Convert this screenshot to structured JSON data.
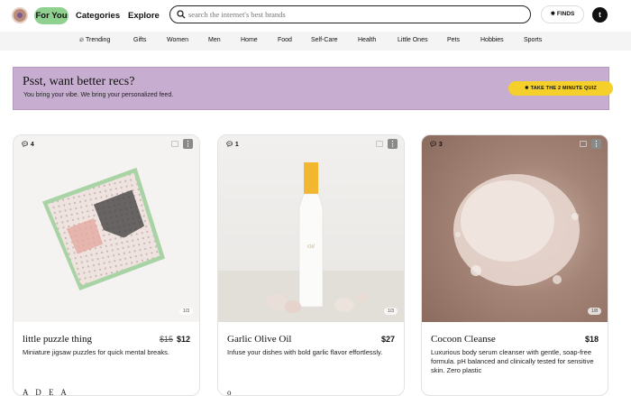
{
  "header": {
    "logo_icon": "flower-logo-icon",
    "tabs": {
      "for_you": "For You",
      "categories": "Categories",
      "explore": "Explore"
    },
    "search": {
      "placeholder": "search the internet's best brands",
      "value": ""
    },
    "finds_label": "FINDS",
    "avatar_initial": "t"
  },
  "category_nav": {
    "items": [
      "Trending",
      "Gifts",
      "Women",
      "Men",
      "Home",
      "Food",
      "Self-Care",
      "Health",
      "Little Ones",
      "Pets",
      "Hobbies",
      "Sports"
    ]
  },
  "banner": {
    "title": "Psst, want better recs?",
    "subtitle": "You bring your vibe. We bring your personalized feed.",
    "quiz_button": "TAKE THE 2 MINUTE QUIZ",
    "background_color": "#c7aed1",
    "button_color": "#f5d02a"
  },
  "cards": [
    {
      "comment_count": "4",
      "pager": "1/3",
      "title": "little puzzle thing",
      "old_price": "$15",
      "price": "$12",
      "description": "Miniature jigsaw puzzles for quick mental breaks.",
      "bottom_text": "A D E A"
    },
    {
      "comment_count": "1",
      "pager": "1/3",
      "title": "Garlic Olive Oil",
      "price": "$27",
      "description": "Infuse your dishes with bold garlic flavor effortlessly.",
      "bottom_text": "o"
    },
    {
      "comment_count": "3",
      "pager": "1/8",
      "title": "Cocoon Cleanse",
      "price": "$18",
      "description": "Luxurious body serum cleanser with gentle, soap-free formula. pH balanced and clinically tested for sensitive skin. Zero plastic",
      "bottom_text": ""
    }
  ]
}
